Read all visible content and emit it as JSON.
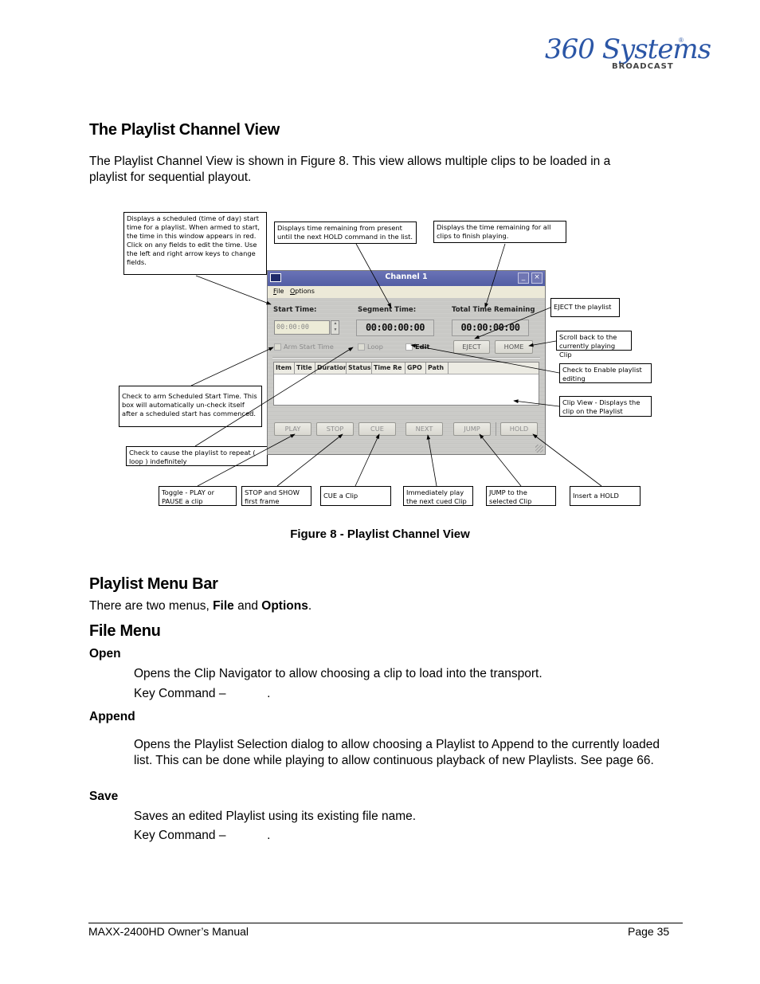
{
  "logo": {
    "script_text": "360 Systems",
    "registered": "®",
    "sub_text": "BROADCAST"
  },
  "section": {
    "title": "The Playlist Channel View",
    "intro_line1": "The Playlist Channel View is shown in Figure 8. This view allows multiple clips to be loaded in a",
    "intro_line2": "playlist for sequential playout."
  },
  "figure": {
    "caption": "Figure 8 - Playlist Channel View",
    "window": {
      "title": "Channel  1",
      "minimize_label": "_",
      "close_label": "×",
      "menus": [
        "File",
        "Options"
      ],
      "start_time_label": "Start Time:",
      "segment_time_label": "Segment Time:",
      "total_time_label": "Total Time Remaining",
      "start_time_value": "00:00:00",
      "segment_time_value": "00:00:00:00",
      "total_time_value": "00:00:00:00",
      "checkboxes": [
        {
          "label": "Arm Start Time",
          "checked": false,
          "enabled": false
        },
        {
          "label": "Loop",
          "checked": false,
          "enabled": false
        },
        {
          "label": "Edit",
          "checked": false,
          "enabled": true
        }
      ],
      "eject_label": "EJECT",
      "home_label": "HOME",
      "columns": [
        "Item",
        "Title",
        "Duration",
        "Status",
        "Time Re",
        "GPO",
        "Path"
      ],
      "transport_buttons": [
        "PLAY",
        "STOP",
        "CUE",
        "NEXT",
        "JUMP",
        "HOLD"
      ]
    },
    "callouts": {
      "start_time": "Displays  a scheduled (time of day) start time for a playlist. When armed to start, the time in this window appears in red. Click on any fields to edit the time.  Use the left and right arrow keys to change fields.",
      "segment_time": "Displays time remaining from present until the next HOLD command in the list.",
      "total_time": "Displays the time remaining for all clips to finish playing.",
      "eject": "EJECT the playlist",
      "home": "Scroll back to the currently playing Clip",
      "edit": "Check to Enable playlist editing",
      "clip_view": "Clip View - Displays the clip on the Playlist",
      "arm": "Check to arm Scheduled Start Time.  This box will automatically un-check itself after a scheduled start has commenced.",
      "loop": "Check to cause the playlist to repeat ( loop ) indefinitely",
      "play": "Toggle - PLAY or PAUSE a clip",
      "stop": "STOP and SHOW first frame",
      "cue": "CUE a Clip",
      "next": "Immediately play the next cued Clip",
      "jump": "JUMP to the selected Clip",
      "hold": "Insert a HOLD"
    }
  },
  "menu_bar_section": {
    "title": "Playlist Menu Bar",
    "text_prefix": "There are two menus, ",
    "file": "File",
    "and": " and ",
    "options": "Options",
    "end": "."
  },
  "file_menu": {
    "title": "File Menu",
    "items": [
      {
        "name": "Open",
        "desc": "Opens the Clip Navigator to allow choosing a clip to load into the transport.",
        "key": "Key Command –            ."
      },
      {
        "name": "Append",
        "desc": "Opens the Playlist Selection dialog to allow choosing a Playlist to Append to the currently loaded list.  This can be done while playing to allow continuous playback of new Playlists. See page 66."
      },
      {
        "name": "Save",
        "desc": "Saves an edited Playlist using its existing file name.",
        "key": "Key Command –            ."
      }
    ]
  },
  "footer": {
    "left": "MAXX-2400HD Owner’s Manual",
    "right": "Page 35"
  }
}
